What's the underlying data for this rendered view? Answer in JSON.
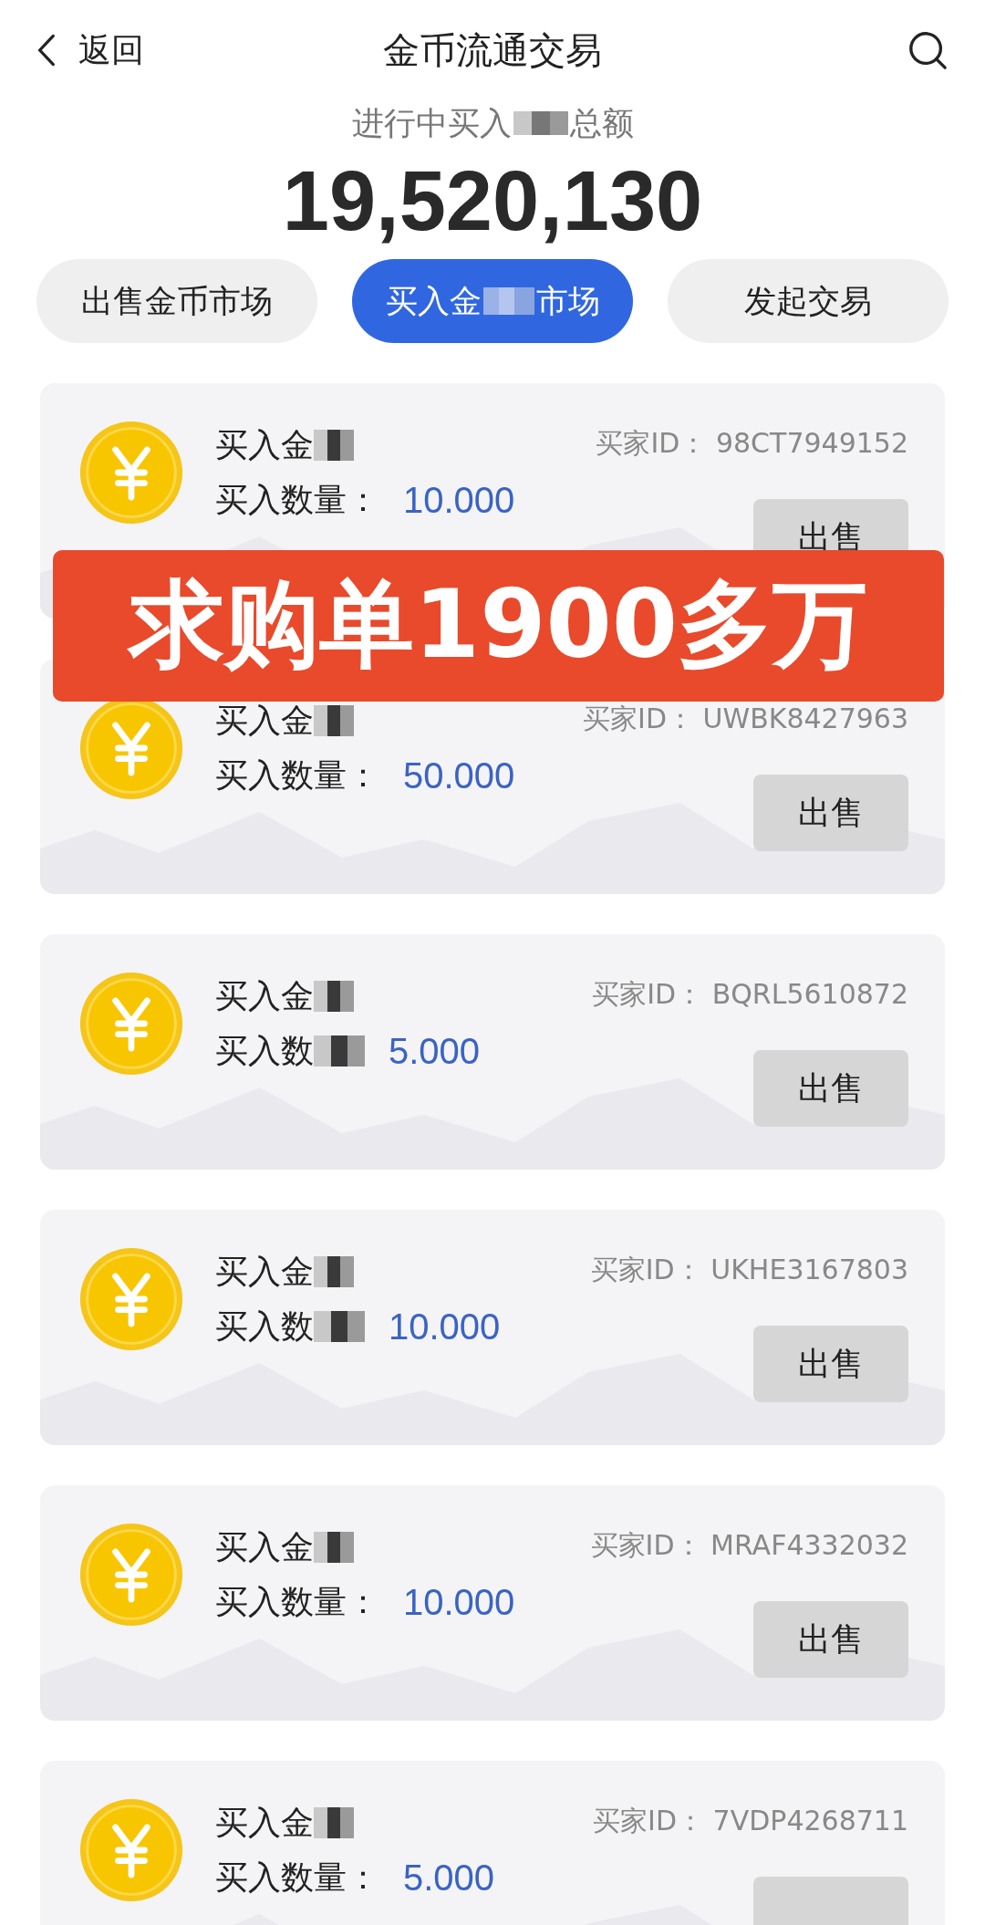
{
  "header": {
    "back_label": "返回",
    "title": "金币流通交易"
  },
  "summary": {
    "label_start": "进行中买入",
    "label_end": "总额",
    "total": "19,520,130"
  },
  "tabs": [
    {
      "label": "出售金币市场",
      "selected": false
    },
    {
      "label": "买入金",
      "label_end": "市场",
      "selected": true
    },
    {
      "label": "发起交易",
      "selected": false
    }
  ],
  "banner": {
    "text": "求购单1900多万"
  },
  "orders": [
    {
      "name": "买入金",
      "qty_label": "买入数量：",
      "qty_label_masked": false,
      "qty": "10.000",
      "buyer_label": "买家ID：",
      "buyer_id": "98CT7949152",
      "button": "出售"
    },
    {
      "name": "买入金",
      "qty_label": "买入数量：",
      "qty_label_masked": false,
      "qty": "50.000",
      "buyer_label": "买家ID：",
      "buyer_id": "UWBK8427963",
      "button": "出售"
    },
    {
      "name": "买入金",
      "qty_label": "买入数",
      "qty_label_masked": true,
      "qty": "5.000",
      "buyer_label": "买家ID：",
      "buyer_id": "BQRL5610872",
      "button": "出售"
    },
    {
      "name": "买入金",
      "qty_label": "买入数",
      "qty_label_masked": true,
      "qty": "10.000",
      "buyer_label": "买家ID：",
      "buyer_id": "UKHE3167803",
      "button": "出售"
    },
    {
      "name": "买入金",
      "qty_label": "买入数量：",
      "qty_label_masked": false,
      "qty": "10.000",
      "buyer_label": "买家ID：",
      "buyer_id": "MRAF4332032",
      "button": "出售"
    },
    {
      "name": "买入金",
      "qty_label": "买入数量：",
      "qty_label_masked": false,
      "qty": "5.000",
      "buyer_label": "买家ID：",
      "buyer_id": "7VDP4268711"
    }
  ]
}
